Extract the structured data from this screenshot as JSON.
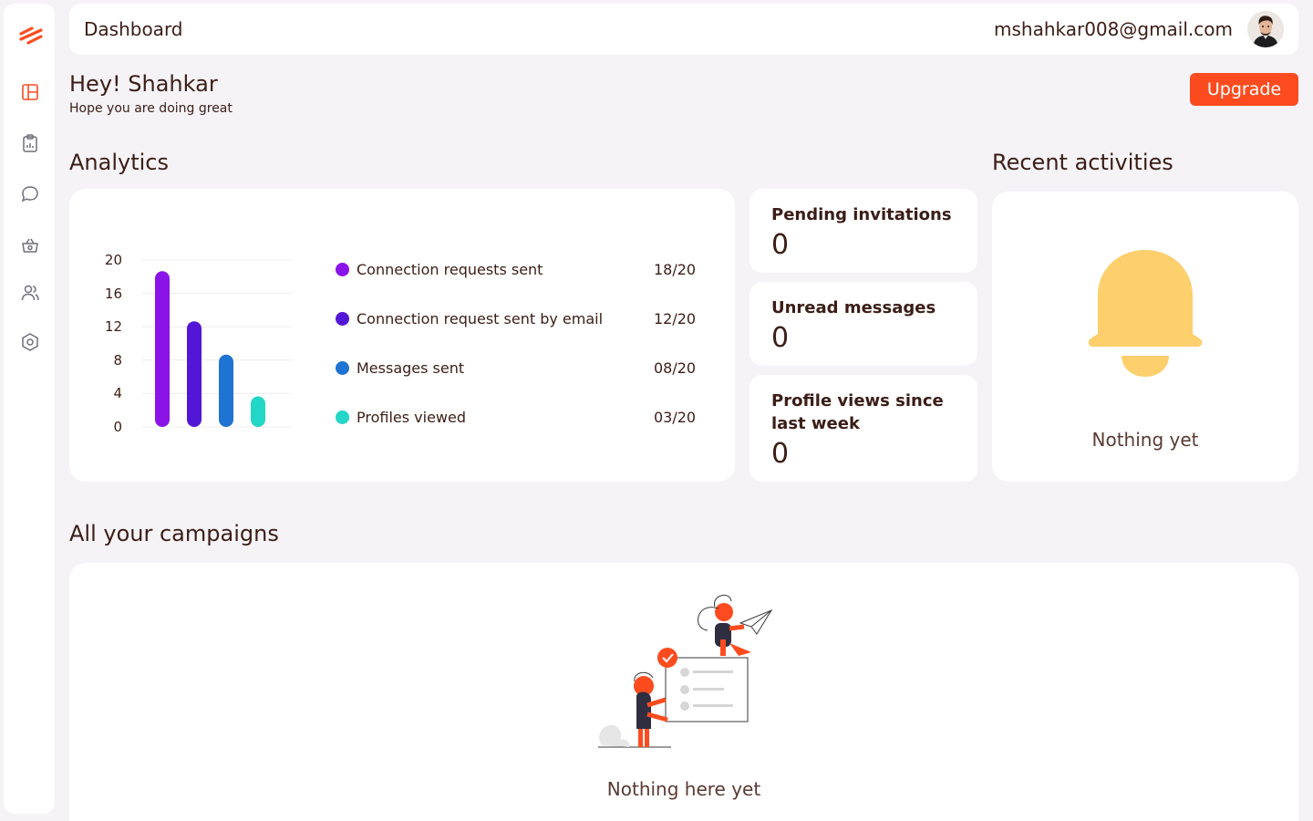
{
  "sidebar": {
    "logo": "brand-logo-stripes",
    "items": [
      {
        "name": "dashboard",
        "icon": "layout-icon",
        "active": true
      },
      {
        "name": "campaigns",
        "icon": "clipboard-icon"
      },
      {
        "name": "messages",
        "icon": "chat-bubble-icon"
      },
      {
        "name": "store",
        "icon": "basket-icon"
      },
      {
        "name": "contacts",
        "icon": "users-icon"
      },
      {
        "name": "settings",
        "icon": "hexagon-gear-icon"
      }
    ]
  },
  "header": {
    "title": "Dashboard",
    "email": "mshahkar008@gmail.com"
  },
  "greeting": {
    "title": "Hey! Shahkar",
    "subtitle": "Hope you are doing great",
    "upgrade_label": "Upgrade"
  },
  "analytics": {
    "section_title": "Analytics"
  },
  "chart_data": {
    "type": "bar",
    "categories": [
      "Connection requests sent",
      "Connection request sent by email",
      "Messages sent",
      "Profiles viewed"
    ],
    "values": [
      18,
      12,
      8,
      3
    ],
    "display_values": [
      "18/20",
      "12/20",
      "08/20",
      "03/20"
    ],
    "colors": [
      "#8a14e8",
      "#5217d6",
      "#1f73d2",
      "#23d6c6"
    ],
    "y_ticks": [
      "20",
      "16",
      "12",
      "8",
      "4",
      "0"
    ],
    "ylim": [
      0,
      20
    ],
    "grid": true,
    "legend": "right"
  },
  "stats": [
    {
      "label": "Pending invitations",
      "value": "0"
    },
    {
      "label": "Unread messages",
      "value": "0"
    },
    {
      "label": "Profile views since last week",
      "value": "0"
    }
  ],
  "recent_activities": {
    "section_title": "Recent activities",
    "empty_text": "Nothing yet"
  },
  "campaigns": {
    "section_title": "All your campaigns",
    "empty_text": "Nothing here yet"
  },
  "colors": {
    "accent": "#fc4c1f",
    "bell": "#fdcf6d",
    "background": "#f5f3f6",
    "text": "#3b1d17"
  }
}
